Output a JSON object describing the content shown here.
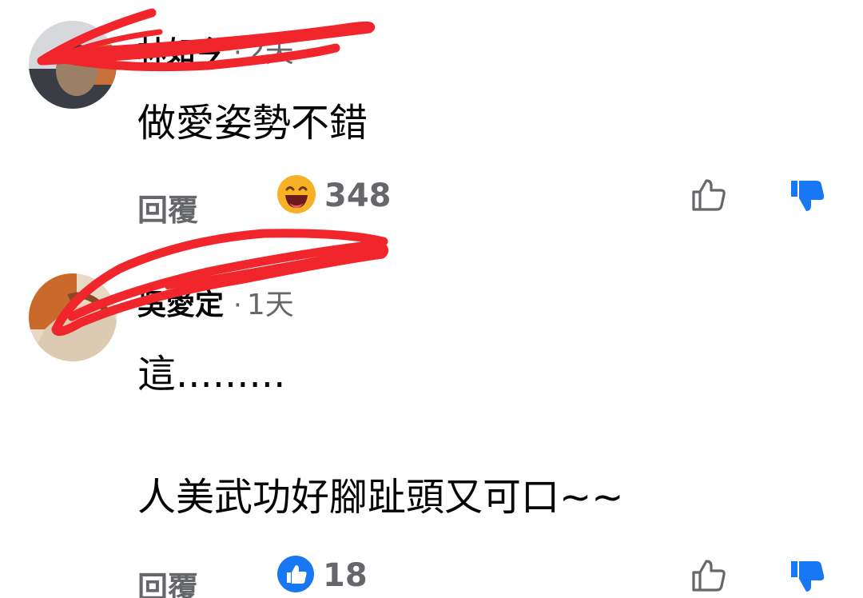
{
  "comments": [
    {
      "author": "林如今",
      "separator": "·",
      "time": "2天",
      "text": "做愛姿勢不錯",
      "reply_label": "回覆",
      "reaction_icon": "haha-emoji-icon",
      "reaction_count": "348",
      "upvote_icon": "thumbs-up-outline-icon",
      "downvote_icon": "thumbs-down-filled-icon"
    },
    {
      "author": "吳愛定",
      "separator": "·",
      "time": "1天",
      "text_line1": "這.........",
      "text_line2": "人美武功好腳趾頭又可口~~",
      "reply_label": "回覆",
      "reaction_icon": "like-reaction-icon",
      "reaction_count": "18",
      "upvote_icon": "thumbs-up-outline-icon",
      "downvote_icon": "thumbs-down-filled-icon"
    }
  ],
  "colors": {
    "text_primary": "#050505",
    "text_secondary": "#65676b",
    "like_blue": "#1877f2",
    "haha_yellow": "#f7b125",
    "scribble_red": "#f0262c"
  }
}
